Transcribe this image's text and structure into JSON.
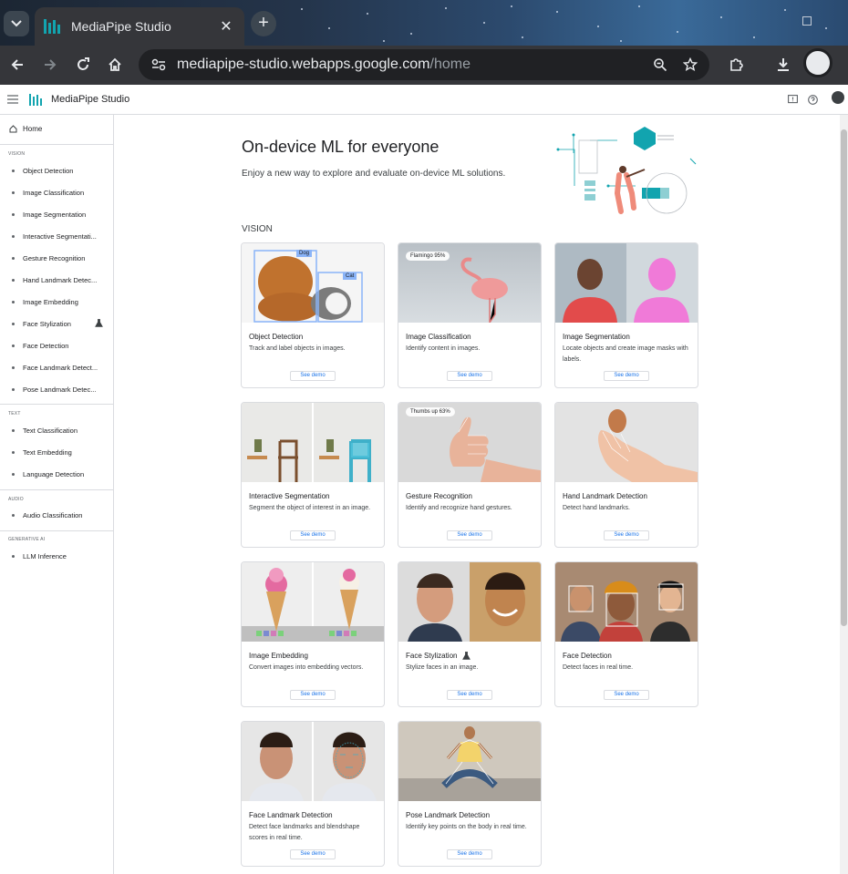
{
  "browser": {
    "tab_title": "MediaPipe Studio",
    "url_host": "mediapipe-studio.webapps.google.com",
    "url_path": "/home"
  },
  "app": {
    "name": "MediaPipe Studio"
  },
  "sidebar": {
    "home": "Home",
    "sections": [
      {
        "title": "VISION",
        "items": [
          "Object Detection",
          "Image Classification",
          "Image Segmentation",
          "Interactive Segmentati...",
          "Gesture Recognition",
          "Hand Landmark Detec...",
          "Image Embedding",
          "Face Stylization",
          "Face Detection",
          "Face Landmark Detect...",
          "Pose Landmark Detec..."
        ]
      },
      {
        "title": "TEXT",
        "items": [
          "Text Classification",
          "Text Embedding",
          "Language Detection"
        ]
      },
      {
        "title": "AUDIO",
        "items": [
          "Audio Classification"
        ]
      },
      {
        "title": "GENERATIVE AI",
        "items": [
          "LLM Inference"
        ]
      }
    ]
  },
  "hero": {
    "title": "On-device ML for everyone",
    "subtitle": "Enjoy a new way to explore and evaluate on-device ML solutions."
  },
  "section_label": "VISION",
  "demo_label": "See demo",
  "cards": [
    {
      "title": "Object Detection",
      "desc": "Track and label objects in images.",
      "labels": [
        "Dog",
        "Cat"
      ]
    },
    {
      "title": "Image Classification",
      "desc": "Identify content in images.",
      "chip": "Flamingo 95%"
    },
    {
      "title": "Image Segmentation",
      "desc": "Locate objects and create image masks with labels."
    },
    {
      "title": "Interactive Segmentation",
      "desc": "Segment the object of interest in an image."
    },
    {
      "title": "Gesture Recognition",
      "desc": "Identify and recognize hand gestures.",
      "chip": "Thumbs up 63%"
    },
    {
      "title": "Hand Landmark Detection",
      "desc": "Detect hand landmarks."
    },
    {
      "title": "Image Embedding",
      "desc": "Convert images into embedding vectors."
    },
    {
      "title": "Face Stylization",
      "desc": "Stylize faces in an image."
    },
    {
      "title": "Face Detection",
      "desc": "Detect faces in real time."
    },
    {
      "title": "Face Landmark Detection",
      "desc": "Detect face landmarks and blendshape scores in real time."
    },
    {
      "title": "Pose Landmark Detection",
      "desc": "Identify key points on the body in real time."
    }
  ],
  "colors": {
    "accent": "#12a4af",
    "link": "#1a73e8",
    "chrome": "#35363a"
  }
}
